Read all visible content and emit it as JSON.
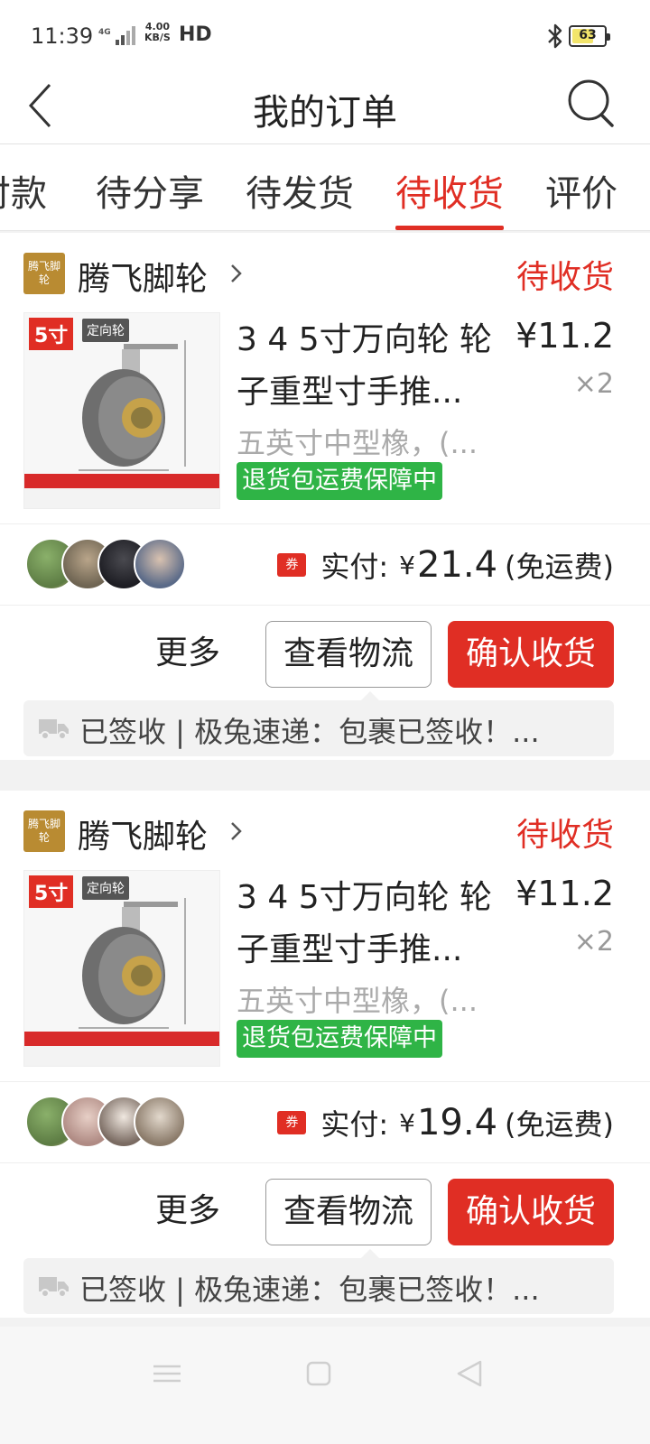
{
  "status_bar": {
    "time": "11:39",
    "network": "4G",
    "speed_value": "4.00",
    "speed_unit": "KB/S",
    "hd": "HD",
    "battery": "63"
  },
  "header": {
    "title": "我的订单",
    "back_icon": "chevron-left-icon",
    "search_icon": "search-icon"
  },
  "tabs": [
    {
      "label": "付款",
      "active": false
    },
    {
      "label": "待分享",
      "active": false
    },
    {
      "label": "待发货",
      "active": false
    },
    {
      "label": "待收货",
      "active": true
    },
    {
      "label": "评价",
      "active": false
    }
  ],
  "orders": [
    {
      "shop_logo_text": "腾飞脚轮",
      "shop_name": "腾飞脚轮",
      "status": "待收货",
      "thumb": {
        "size_tag": "5寸",
        "type_tag": "定向轮"
      },
      "product_title": "3 4 5寸万向轮 轮子重型寸手推...",
      "price": "¥11.2",
      "qty": "×2",
      "spec": "五英寸中型橡，(...",
      "guarantee": "退货包运费保障中",
      "coupon": "券",
      "pay_label": "实付:",
      "pay_currency": "¥",
      "pay_amount": "21.4",
      "pay_note": "(免运费)",
      "buttons": {
        "more": "更多",
        "logistics": "查看物流",
        "confirm": "确认收货"
      },
      "logistics_text": "已签收 | 极兔速递：包裹已签收！..."
    },
    {
      "shop_logo_text": "腾飞脚轮",
      "shop_name": "腾飞脚轮",
      "status": "待收货",
      "thumb": {
        "size_tag": "5寸",
        "type_tag": "定向轮"
      },
      "product_title": "3 4 5寸万向轮 轮子重型寸手推...",
      "price": "¥11.2",
      "qty": "×2",
      "spec": "五英寸中型橡，(...",
      "guarantee": "退货包运费保障中",
      "coupon": "券",
      "pay_label": "实付:",
      "pay_currency": "¥",
      "pay_amount": "19.4",
      "pay_note": "(免运费)",
      "buttons": {
        "more": "更多",
        "logistics": "查看物流",
        "confirm": "确认收货"
      },
      "logistics_text": "已签收 | 极兔速递：包裹已签收！..."
    }
  ],
  "colors": {
    "accent": "#e02e24",
    "guarantee": "#2fb446",
    "shop_logo": "#b98b32"
  },
  "nav_bar": {
    "menu_icon": "menu-icon",
    "home_icon": "home-square-icon",
    "back_icon": "back-triangle-icon"
  }
}
